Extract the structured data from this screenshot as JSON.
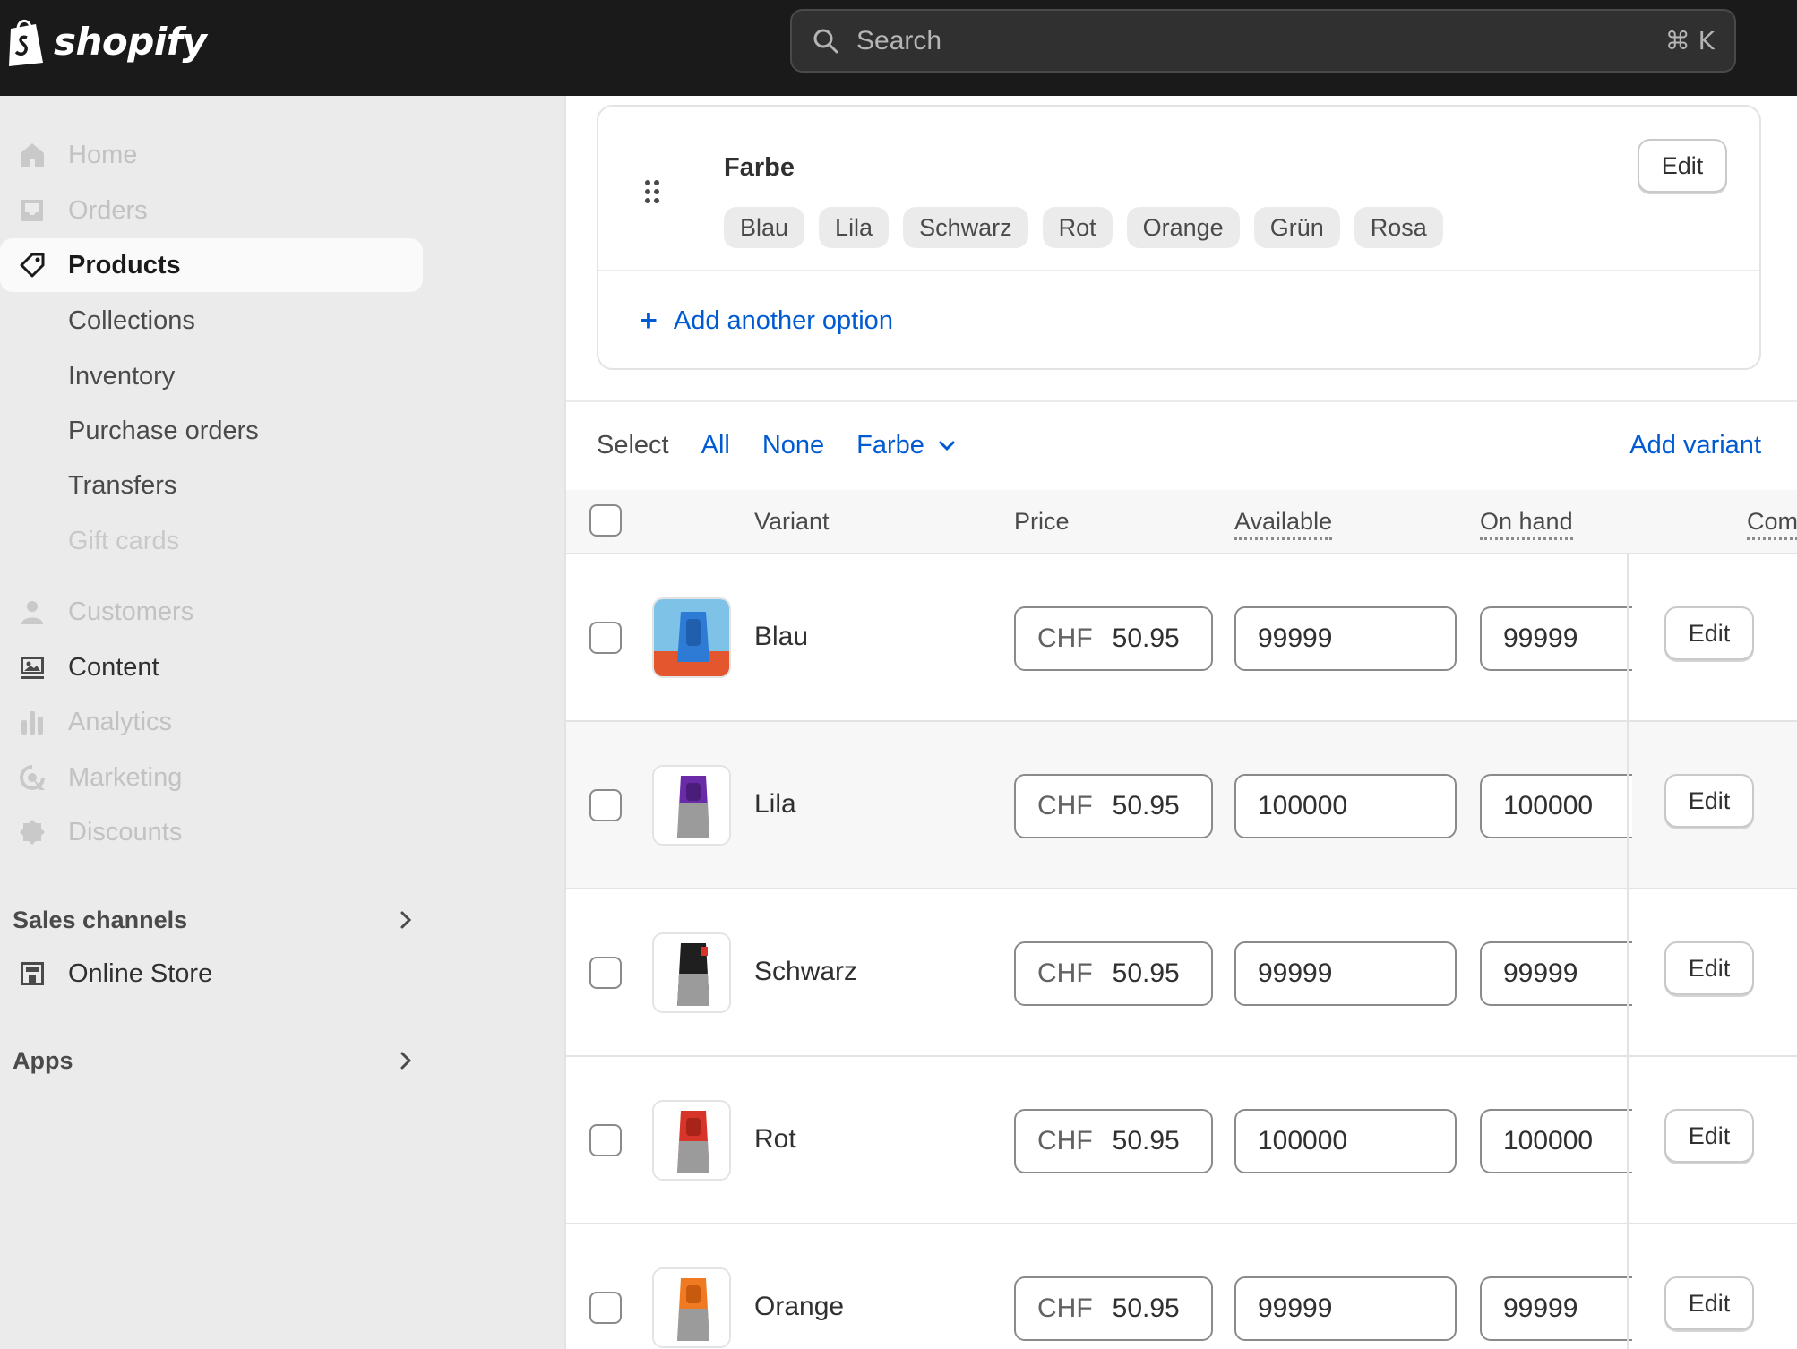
{
  "topbar": {
    "brand": "shopify",
    "search_placeholder": "Search",
    "search_shortcut": "⌘ K"
  },
  "sidebar": {
    "items": [
      {
        "label": "Home",
        "icon": "home-icon",
        "state": "disabled"
      },
      {
        "label": "Orders",
        "icon": "inbox-icon",
        "state": "disabled"
      },
      {
        "label": "Products",
        "icon": "tag-icon",
        "state": "active"
      },
      {
        "label": "Collections",
        "state": "sub"
      },
      {
        "label": "Inventory",
        "state": "sub"
      },
      {
        "label": "Purchase orders",
        "state": "sub"
      },
      {
        "label": "Transfers",
        "state": "sub"
      },
      {
        "label": "Gift cards",
        "state": "sub-disabled"
      },
      {
        "label": "Customers",
        "icon": "person-icon",
        "state": "disabled"
      },
      {
        "label": "Content",
        "icon": "image-icon",
        "state": "enabled"
      },
      {
        "label": "Analytics",
        "icon": "bar-chart-icon",
        "state": "disabled"
      },
      {
        "label": "Marketing",
        "icon": "target-icon",
        "state": "disabled"
      },
      {
        "label": "Discounts",
        "icon": "discount-icon",
        "state": "disabled"
      }
    ],
    "sales_channels_label": "Sales channels",
    "online_store_label": "Online Store",
    "apps_label": "Apps"
  },
  "option": {
    "name": "Farbe",
    "edit_label": "Edit",
    "values": [
      "Blau",
      "Lila",
      "Schwarz",
      "Rot",
      "Orange",
      "Grün",
      "Rosa"
    ],
    "add_another_label": "Add another option"
  },
  "select_bar": {
    "select_label": "Select",
    "all_label": "All",
    "none_label": "None",
    "dropdown_label": "Farbe",
    "add_variant_label": "Add variant"
  },
  "table": {
    "headers": {
      "variant": "Variant",
      "price": "Price",
      "available": "Available",
      "on_hand": "On hand",
      "committed": "Com"
    },
    "currency": "CHF",
    "edit_label": "Edit",
    "rows": [
      {
        "name": "Blau",
        "price": "50.95",
        "available": "99999",
        "on_hand": "99999",
        "color": "#2e7bd6"
      },
      {
        "name": "Lila",
        "price": "50.95",
        "available": "100000",
        "on_hand": "100000",
        "color": "#6a2ba8"
      },
      {
        "name": "Schwarz",
        "price": "50.95",
        "available": "99999",
        "on_hand": "99999",
        "color": "#1f1f1f"
      },
      {
        "name": "Rot",
        "price": "50.95",
        "available": "100000",
        "on_hand": "100000",
        "color": "#d8352a"
      },
      {
        "name": "Orange",
        "price": "50.95",
        "available": "99999",
        "on_hand": "99999",
        "color": "#f07a22"
      }
    ]
  },
  "colors": {
    "accent_link": "#005bd3",
    "topbar_bg": "#1a1a1a",
    "sidebar_bg": "#ebebeb"
  }
}
